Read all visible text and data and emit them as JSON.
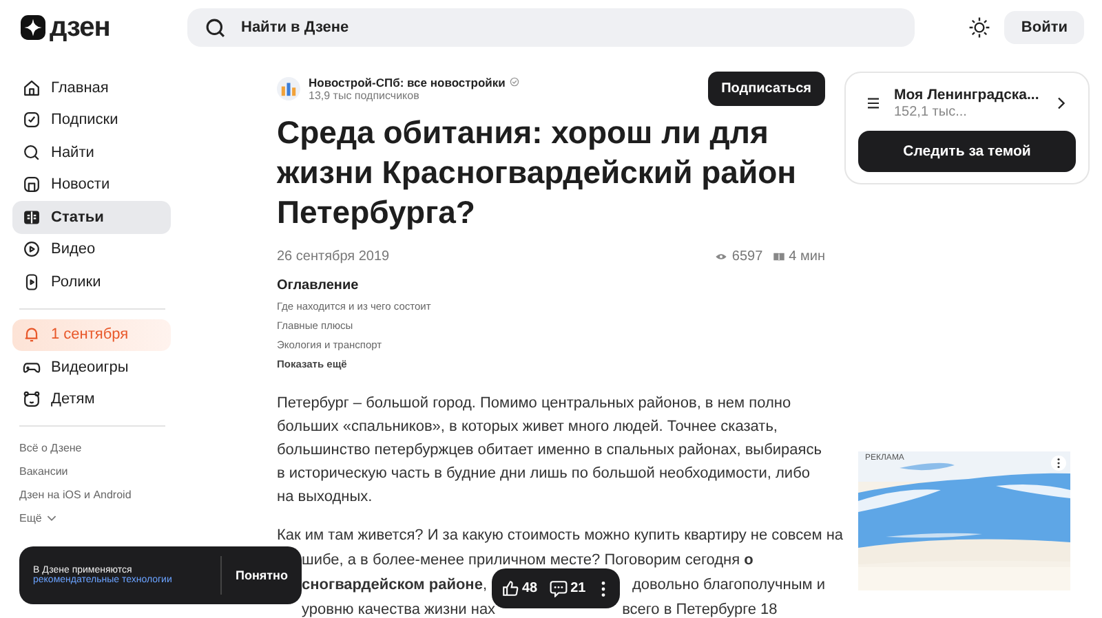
{
  "header": {
    "logo": "дзен",
    "search": {
      "placeholder": "Найти в Дзене"
    },
    "login": "Войти"
  },
  "sidebar": {
    "items": [
      {
        "label": "Главная",
        "kind": "nav",
        "selected": false
      },
      {
        "label": "Подписки",
        "kind": "nav",
        "selected": false
      },
      {
        "label": "Найти",
        "kind": "nav",
        "selected": false
      },
      {
        "label": "Новости",
        "kind": "nav",
        "selected": false
      },
      {
        "label": "Статьи",
        "kind": "nav",
        "selected": true
      },
      {
        "label": "Видео",
        "kind": "nav",
        "selected": false
      },
      {
        "label": "Ролики",
        "kind": "nav",
        "selected": false
      },
      {
        "label": "1 сентября",
        "kind": "promo",
        "selected": false
      },
      {
        "label": "Видеоигры",
        "kind": "nav",
        "selected": false
      },
      {
        "label": "Детям",
        "kind": "nav",
        "selected": false
      }
    ],
    "footer_links": [
      "Всё о Дзене",
      "Вакансии",
      "Дзен на iOS и Android"
    ],
    "more": "Ещё"
  },
  "article": {
    "channel": {
      "name": "Новострой-СПб: все новостройки",
      "subscribers": "13,9 тыс подписчиков"
    },
    "subscribe": "Подписаться",
    "title": "Среда обитания: хорош ли для жизни Красногвардейский район Петербурга?",
    "date": "26 сентября 2019",
    "views": "6597",
    "read_time": "4 мин",
    "toc": {
      "heading": "Оглавление",
      "items": [
        "Где находится и из чего состоит",
        "Главные плюсы",
        "Экология и транспорт"
      ],
      "more": "Показать ещё"
    },
    "paragraph": "Петербург – большой город. Помимо центральных районов, в нем полно больших «спальников», в которых живет много людей. Точнее сказать, большинство петербуржцев обитает именно в спальных районах, выбираясь в историческую часть в будние дни лишь по большой необходимости, либо на выходных.",
    "partial_lines": [
      [
        "Как им там живется? И за какую стоимость можно купить квартиру не совсем на"
      ],
      [
        "шибе, а в более-менее приличном месте? Поговорим сегодня **о**"
      ],
      [
        "**сногвардейском районе**,",
        "довольно благополучным и"
      ],
      [
        "уровню качества жизни нах",
        "всего в Петербурге 18"
      ]
    ]
  },
  "reactions": {
    "likes": "48",
    "comments": "21"
  },
  "cookie_banner": {
    "text": "В Дзене применяются",
    "link": "рекомендательные технологии",
    "button": "Понятно"
  },
  "topic_card": {
    "name": "Моя Ленинградска...",
    "count": "152,1 тыс...",
    "button": "Следить за темой"
  },
  "ad": {
    "label": "РЕКЛАМА",
    "kind": "picture"
  }
}
